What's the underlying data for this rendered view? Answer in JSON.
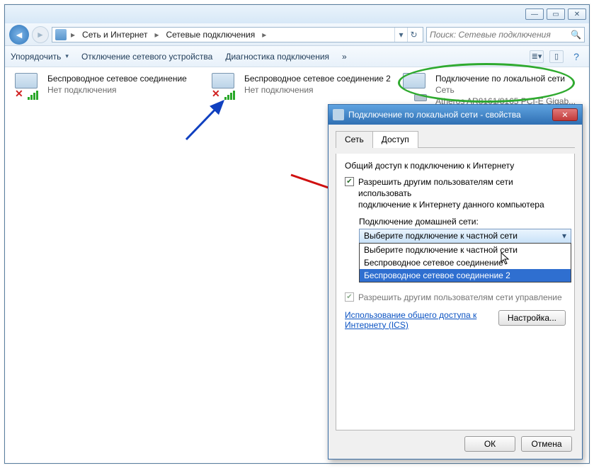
{
  "titlebar": {
    "min": "—",
    "max": "▭",
    "close": "✕"
  },
  "breadcrumb": {
    "a": "Сеть и Интернет",
    "b": "Сетевые подключения"
  },
  "search": {
    "placeholder": "Поиск: Сетевые подключения"
  },
  "toolbar": {
    "organize": "Упорядочить",
    "disable": "Отключение сетевого устройства",
    "diag": "Диагностика подключения",
    "more": "»"
  },
  "connections": [
    {
      "name": "Беспроводное сетевое соединение",
      "sub": "Нет подключения",
      "type": "wifi",
      "disconnected": true
    },
    {
      "name": "Беспроводное сетевое соединение 2",
      "sub": "Нет подключения",
      "type": "wifi",
      "disconnected": true
    },
    {
      "name": "Подключение по локальной сети",
      "sub": "Сеть",
      "detail": "Atheros AR8161/8165 PCI-E Gigab...",
      "type": "lan",
      "disconnected": false
    }
  ],
  "dialog": {
    "title": "Подключение по локальной сети - свойства",
    "tabs": {
      "net": "Сеть",
      "access": "Доступ"
    },
    "group": "Общий доступ к подключению к Интернету",
    "chk1a": "Разрешить другим пользователям сети использовать",
    "chk1b": "подключение к Интернету данного компьютера",
    "homenet_label": "Подключение домашней сети:",
    "select_value": "Выберите подключение к частной сети",
    "options": [
      "Выберите подключение к частной сети",
      "Беспроводное сетевое соединение",
      "Беспроводное сетевое соединение 2"
    ],
    "chk2": "Разрешить другим пользователям сети управление",
    "link1": "Использование общего доступа к",
    "link2": "Интернету (ICS)",
    "settings": "Настройка...",
    "ok": "ОК",
    "cancel": "Отмена"
  }
}
